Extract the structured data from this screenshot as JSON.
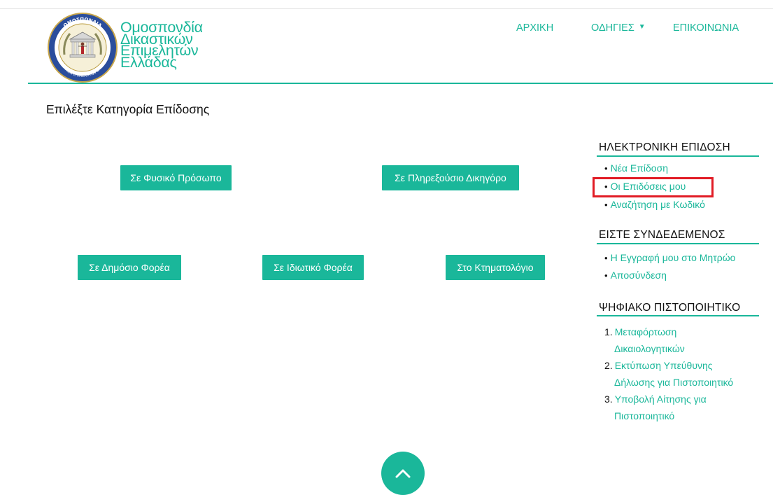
{
  "brand": {
    "lines": [
      "Ομοσπονδία",
      "Δικαστικών",
      "Επιμελητών",
      "Ελλάδας"
    ],
    "logo_text": "ΟΜΟΣΠΟΝΔΙΑ ΔΙΚΑΣΤΙΚΩΝ ΕΠΙΜΕΛΗΤΩΝ ΕΛΛΑΔΑΣ"
  },
  "nav": {
    "home": "ΑΡΧΙΚΗ",
    "instructions": "ΟΔΗΓΙΕΣ",
    "contact": "ΕΠΙΚΟΙΝΩΝΙΑ"
  },
  "page_title": "Επιλέξτε Κατηγορία Επίδοσης",
  "categories": {
    "physical_person": "Σε Φυσικό Πρόσωπο",
    "attorney": "Σε Πληρεξούσιο Δικηγόρο",
    "public_body": "Σε Δημόσιο Φορέα",
    "private_body": "Σε Ιδιωτικό Φορέα",
    "land_registry": "Στο Κτηματολόγιο"
  },
  "sidebar": {
    "eservice": {
      "heading": "ΗΛΕΚΤΡΟΝΙΚΗ ΕΠΙΔΟΣΗ",
      "items": [
        "Νέα Επίδοση",
        "Οι Επιδόσεις μου",
        "Αναζήτηση με Κωδικό"
      ]
    },
    "account": {
      "heading": "ΕΙΣΤΕ ΣΥΝΔΕΔΕΜΕΝΟΣ",
      "items": [
        "Η Εγγραφή μου στο Μητρώο",
        "Αποσύνδεση"
      ]
    },
    "certificate": {
      "heading": "ΨΗΦΙΑΚΟ ΠΙΣΤΟΠΟΙΗΤΙΚΟ",
      "items": [
        {
          "num": "1.",
          "line1": "Μεταφόρτωση",
          "line2": "Δικαιολογητικών"
        },
        {
          "num": "2.",
          "line1": "Εκτύπωση Υπεύθυνης",
          "line2": "Δήλωσης για Πιστοποιητικό"
        },
        {
          "num": "3.",
          "line1": "Υποβολή Αίτησης για",
          "line2": "Πιστοποιητικό"
        }
      ]
    }
  },
  "colors": {
    "accent": "#1ab79a",
    "highlight": "#e11c25"
  }
}
